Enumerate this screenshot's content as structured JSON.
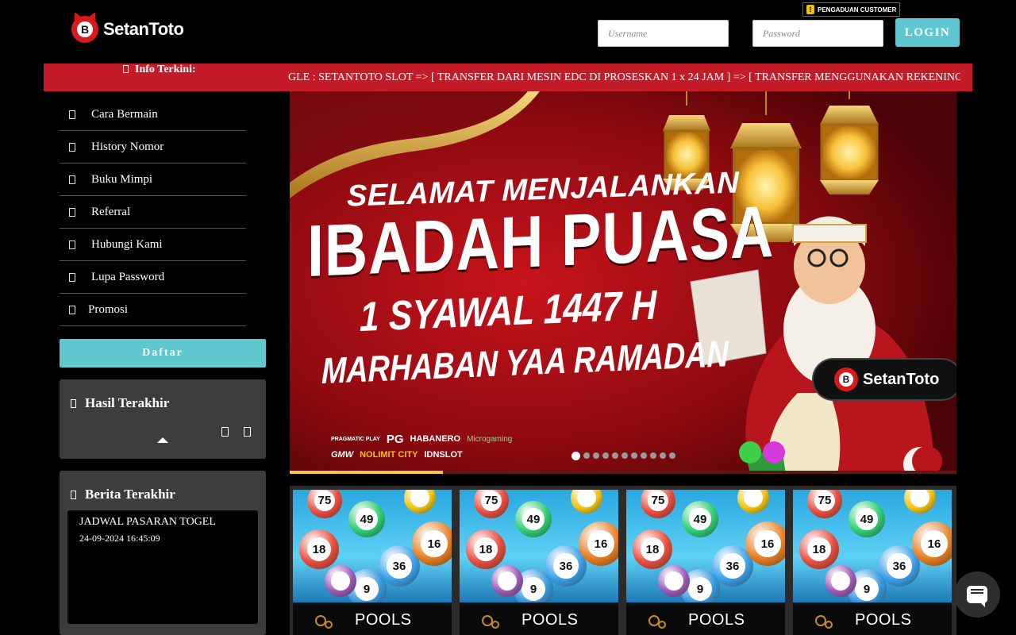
{
  "header": {
    "logo_text": "SetanToto",
    "logo_badge_letter": "B",
    "complaint_label": "PENGADUAN CUSTOMER",
    "username_placeholder": "Username",
    "password_placeholder": "Password",
    "login_label": "LOGIN"
  },
  "ticker": {
    "label": "Info Terkini:",
    "message": "GLE : SETANTOTO SLOT => [ TRANSFER DARI MESIN EDC DI PROSESKAN 1 x 24 JAM ] => [ TRANSFER MENGGUNAKAN REKENING"
  },
  "sidebar": {
    "menu": [
      {
        "label": "Cara Bermain"
      },
      {
        "label": "History Nomor"
      },
      {
        "label": "Buku Mimpi"
      },
      {
        "label": "Referral"
      },
      {
        "label": "Hubungi Kami"
      },
      {
        "label": "Lupa Password"
      },
      {
        "label": "Promosi"
      }
    ],
    "register_label": "Daftar",
    "results_title": "Hasil Terakhir",
    "news_title": "Berita Terakhir",
    "news": [
      {
        "title": "JADWAL PASARAN TOGEL",
        "date": "24-09-2024 16:45:09"
      }
    ]
  },
  "banner": {
    "line1": "SELAMAT MENJALANKAN",
    "line2": "IBADAH PUASA",
    "line3": "1 SYAWAL 1447 H",
    "line4": "MARHABAN YAA RAMADAN",
    "brand": "SetanToto",
    "brand_letter": "B",
    "providers_row1": [
      "PRAGMATIC PLAY",
      "PG",
      "HABANERO",
      "Microgaming"
    ],
    "providers_row2": [
      "GMW",
      "NOLIMIT CITY",
      "IDNSLOT"
    ],
    "slide_count": 11,
    "active_slide": 0,
    "progress_fraction": 0.23,
    "colors": {
      "accent": "#5ec7cf",
      "ticker": "#c41b28",
      "progress": "#f2c94c"
    }
  },
  "games": [
    {
      "label": "POOLS"
    },
    {
      "label": "POOLS"
    },
    {
      "label": "POOLS"
    },
    {
      "label": "POOLS"
    }
  ],
  "ball_numbers": [
    "75",
    "49",
    "18",
    "9",
    "36",
    "16"
  ],
  "chat_icon": "chat-bubble-icon"
}
